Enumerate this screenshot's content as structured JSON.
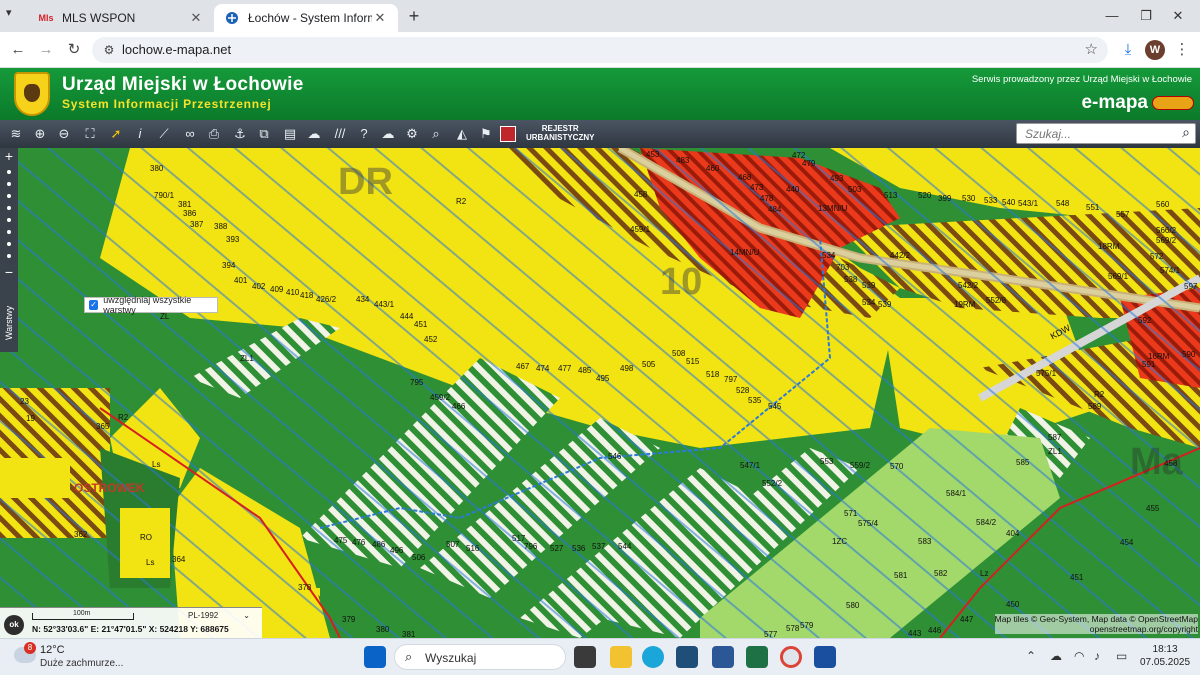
{
  "browser": {
    "tabs": [
      {
        "favicon": "Mls",
        "title": "MLS WSPON"
      },
      {
        "favicon": "emapa",
        "title": "Łochów - System Informacji Przestrzennej"
      }
    ],
    "url": "lochow.e-mapa.net",
    "profile_initial": "W"
  },
  "site": {
    "title": "Urząd Miejski w Łochowie",
    "subtitle": "System Informacji Przestrzennej",
    "service_note": "Serwis prowadzony przez Urząd Miejski w Łochowie",
    "brand": "e-mapa"
  },
  "toolbar": {
    "register_label_1": "REJESTR",
    "register_label_2": "URBANISTYCZNY",
    "search_placeholder": "Szukaj..."
  },
  "map": {
    "layers_checkbox_label": "uwzględniaj wszystkie warstwy",
    "layers_panel_label": "Warstwy",
    "parcels": [
      "453",
      "483",
      "460",
      "468",
      "473",
      "478",
      "484",
      "440",
      "472",
      "479",
      "493",
      "503",
      "513",
      "520",
      "399",
      "530",
      "533",
      "540",
      "543/1",
      "548",
      "551",
      "557",
      "560",
      "566/2",
      "569/2",
      "18RM",
      "572",
      "574/1",
      "569/1",
      "597",
      "592",
      "590",
      "591",
      "16RM",
      "14MN/U",
      "13MN/U",
      "534",
      "703",
      "442/2",
      "538",
      "539",
      "534",
      "539",
      "542/2",
      "552/8",
      "19RM",
      "458",
      "459/1",
      "790/1",
      "381",
      "380",
      "386",
      "387",
      "388",
      "393",
      "394",
      "401",
      "402",
      "409",
      "410",
      "418",
      "426/2",
      "434",
      "443/1",
      "444",
      "451",
      "452",
      "ZL1",
      "ZL",
      "R2",
      "795",
      "459/2",
      "466",
      "467",
      "474",
      "477",
      "485",
      "495",
      "498",
      "505",
      "508",
      "515",
      "518",
      "797",
      "528",
      "535",
      "545",
      "546",
      "547/1",
      "552/2",
      "553",
      "559/2",
      "570",
      "575/1",
      "589",
      "587",
      "585",
      "584/1",
      "584/2",
      "454",
      "455",
      "451",
      "458",
      "R2",
      "ZL1",
      "571",
      "575/4",
      "1ZC",
      "583",
      "581",
      "582",
      "Lz",
      "580",
      "450",
      "447",
      "446",
      "443",
      "577",
      "578",
      "579",
      "404",
      "365",
      "R2",
      "Ls",
      "RO",
      "Ls",
      "364",
      "362",
      "378",
      "379",
      "380",
      "381",
      "475",
      "476",
      "486",
      "496",
      "506",
      "507",
      "516",
      "517",
      "796",
      "527",
      "536",
      "537",
      "544",
      "23",
      "19"
    ],
    "zone_labels": [
      "DR",
      "10",
      "OSTROWEK",
      "KDW",
      "Ma"
    ],
    "scale_label": "100m",
    "crs": "PL-1992",
    "coords": "N: 52°33'03.6\"  E: 21°47'01.5\"  X: 524218   Y: 688675",
    "ok_label": "ok",
    "attribution_1": "Map tiles © Geo-System, Map data © OpenStreetMap",
    "attribution_2": "openstreetmap.org/copyright"
  },
  "taskbar": {
    "temperature": "12°C",
    "condition": "Duże zachmurze...",
    "weather_badge": "8",
    "search_placeholder": "Wyszukaj",
    "time": "18:13",
    "date": "07.05.2025"
  }
}
